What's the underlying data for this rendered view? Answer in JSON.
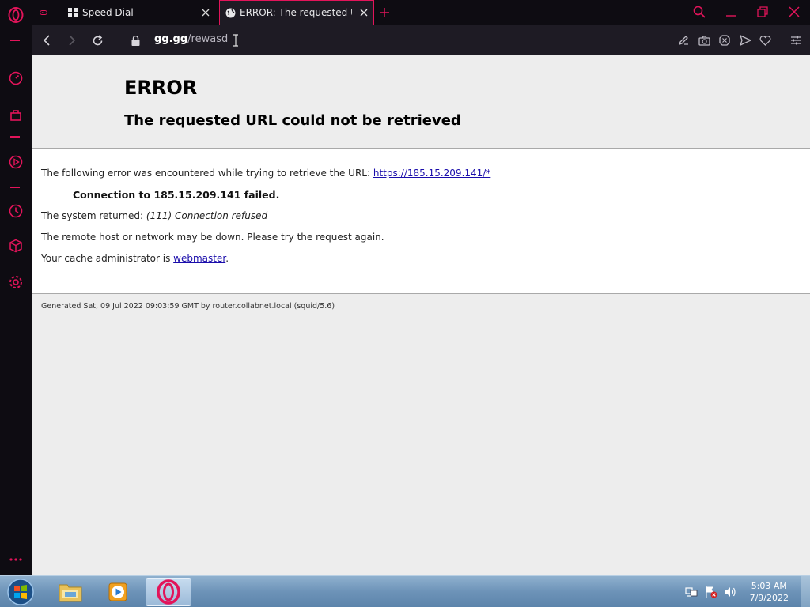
{
  "browser": {
    "tabs": [
      {
        "title": "Speed Dial",
        "icon": "grid-icon"
      },
      {
        "title": "ERROR: The requested URL could not be retrieved",
        "icon": "globe-icon"
      }
    ],
    "address": {
      "host": "gg.gg",
      "path": "/rewasd"
    },
    "accent_color": "#e2145a"
  },
  "page": {
    "title": "ERROR",
    "subtitle": "The requested URL could not be retrieved",
    "line1_prefix": "The following error was encountered while trying to retrieve the URL: ",
    "line1_link": "https://185.15.209.141/*",
    "failure": "Connection to 185.15.209.141 failed.",
    "system_prefix": "The system returned: ",
    "system_value": "(111) Connection refused",
    "remote_msg": "The remote host or network may be down. Please try the request again.",
    "cache_prefix": "Your cache administrator is ",
    "cache_link": "webmaster",
    "cache_suffix": ".",
    "footer": "Generated Sat, 09 Jul 2022 09:03:59 GMT by router.collabnet.local (squid/5.6)"
  },
  "taskbar": {
    "time": "5:03 AM",
    "date": "7/9/2022"
  }
}
